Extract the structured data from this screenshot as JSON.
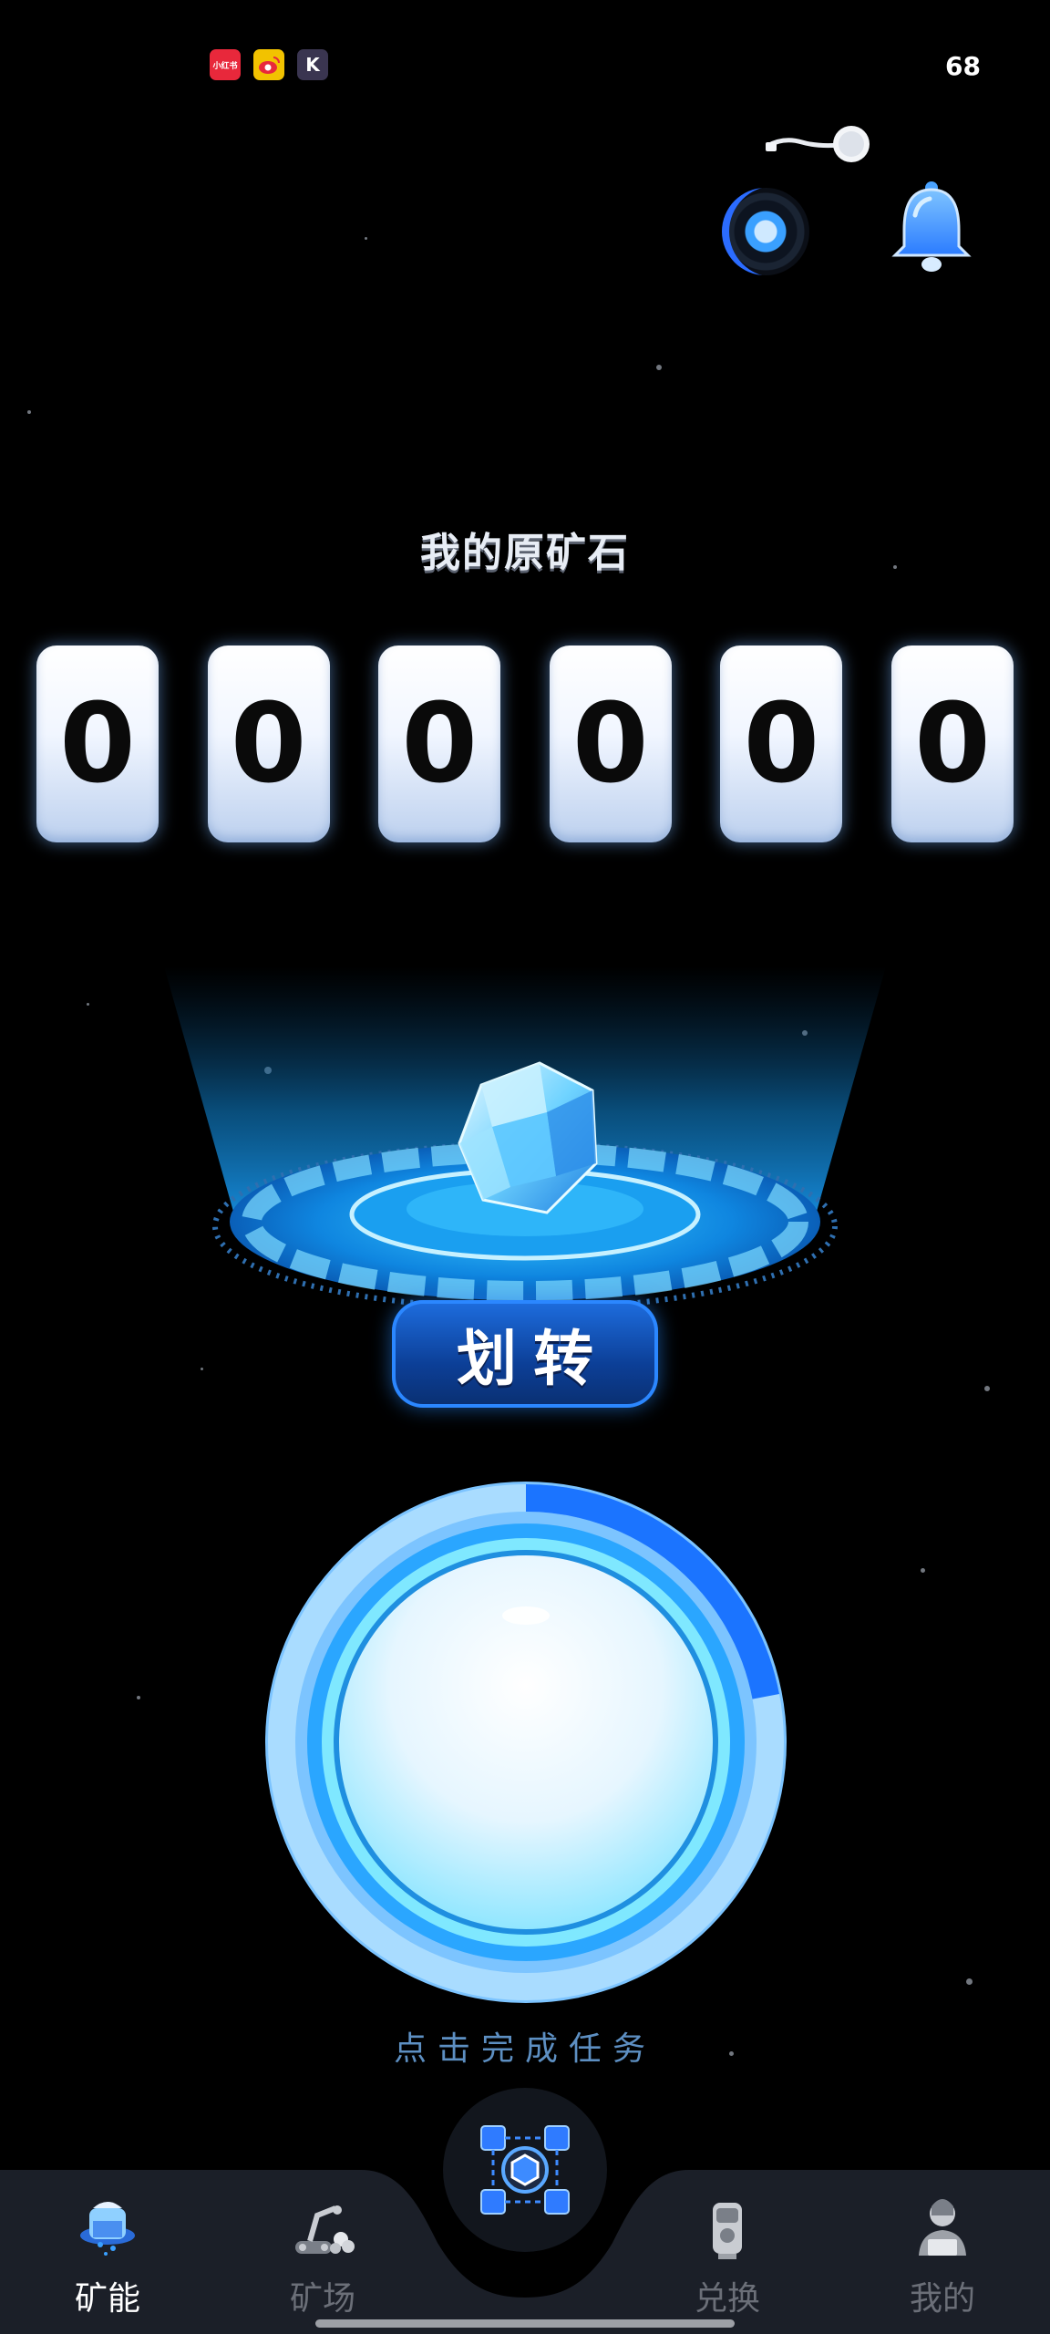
{
  "status_bar": {
    "app_icons": [
      {
        "name": "xiaohongshu-icon",
        "text": "小红书",
        "color": "#e8283b"
      },
      {
        "name": "weibo-icon",
        "text": "",
        "color": "#f2c200"
      },
      {
        "name": "k-app-icon",
        "text": "K",
        "color": "#3a3550"
      }
    ],
    "battery": "68"
  },
  "header": {
    "music_icon": "vinyl-disc-icon",
    "notification_icon": "bell-icon"
  },
  "balance": {
    "title": "我的原矿石",
    "digits": [
      "0",
      "0",
      "0",
      "0",
      "0",
      "0"
    ]
  },
  "platform": {
    "gem_icon": "crystal-gem-icon",
    "transfer_label": "划转"
  },
  "task": {
    "label": "点击完成任务",
    "progress": 0.22
  },
  "nav": {
    "items": [
      {
        "label": "矿能",
        "icon": "mining-energy-icon",
        "active": true
      },
      {
        "label": "矿场",
        "icon": "mine-field-icon",
        "active": false
      },
      {
        "label": "兑换",
        "icon": "exchange-icon",
        "active": false
      },
      {
        "label": "我的",
        "icon": "profile-icon",
        "active": false
      }
    ],
    "center_icon": "blockchain-cube-icon"
  },
  "colors": {
    "accent": "#2b87ff",
    "glow": "#3fd0ff",
    "background": "#000000"
  }
}
